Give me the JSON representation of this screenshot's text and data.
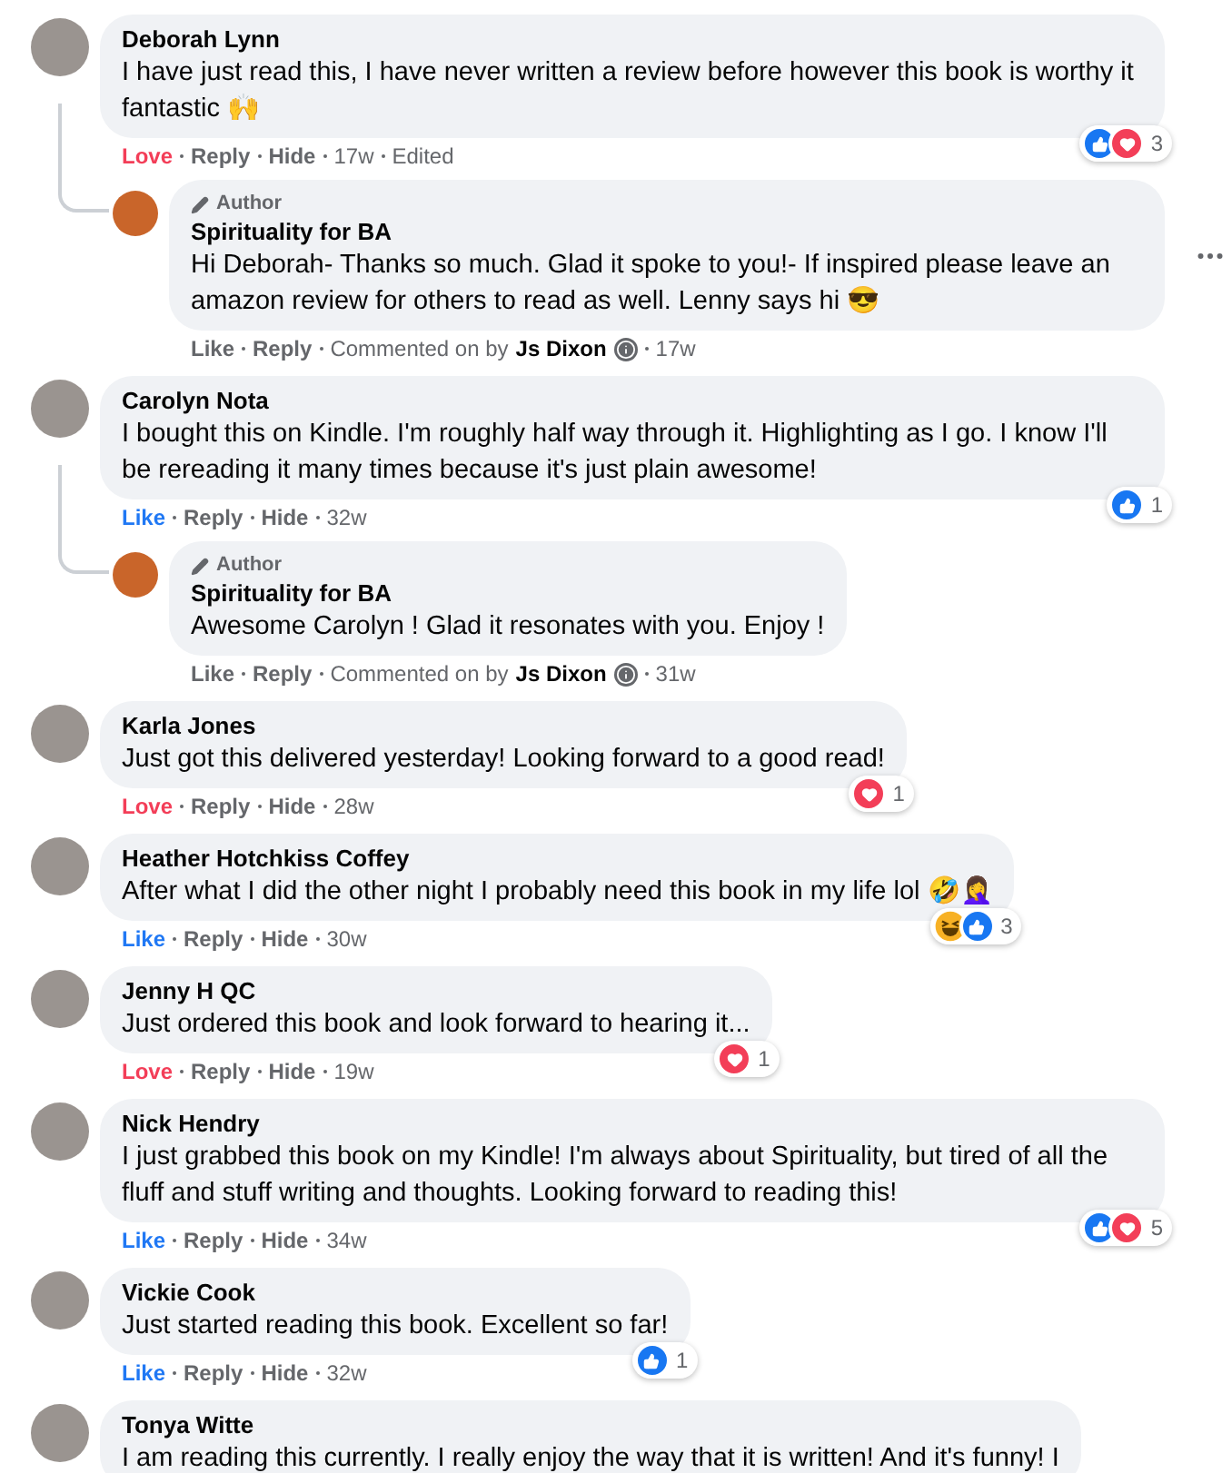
{
  "comments": [
    {
      "name": "Deborah Lynn",
      "text": "I have just read this, I have never written a review before however this book is worthy it fantastic 🙌",
      "react": {
        "label": "Love",
        "kind": "love"
      },
      "actions": [
        "Reply",
        "Hide"
      ],
      "time": "17w",
      "edited": "Edited",
      "reactions": {
        "icons": [
          {
            "kind": "like"
          },
          {
            "kind": "love"
          }
        ],
        "count": "3"
      },
      "replies": [
        {
          "badge": "Author",
          "name": "Spirituality for BA",
          "text": "Hi Deborah- Thanks so much. Glad it spoke to you!- If inspired please leave an amazon review for others to read as well. Lenny says hi 😎",
          "react": {
            "label": "Like",
            "kind": "none"
          },
          "actions": [
            "Reply"
          ],
          "commented_label": "Commented on by",
          "commented_by": "Js Dixon",
          "time": "17w",
          "menu_visible": true
        }
      ]
    },
    {
      "name": "Carolyn Nota",
      "text": "I bought this on Kindle. I'm roughly half way through it. Highlighting as I go. I know I'll be rereading it many times because it's just plain awesome!",
      "react": {
        "label": "Like",
        "kind": "like"
      },
      "actions": [
        "Reply",
        "Hide"
      ],
      "time": "32w",
      "reactions": {
        "icons": [
          {
            "kind": "like"
          }
        ],
        "count": "1"
      },
      "replies": [
        {
          "badge": "Author",
          "name": "Spirituality for BA",
          "text": "Awesome Carolyn ! Glad it resonates with you. Enjoy !",
          "react": {
            "label": "Like",
            "kind": "none"
          },
          "actions": [
            "Reply"
          ],
          "commented_label": "Commented on by",
          "commented_by": "Js Dixon",
          "time": "31w",
          "menu_visible": false
        }
      ]
    },
    {
      "name": "Karla Jones",
      "text": "Just got this delivered yesterday! Looking forward to a good read!",
      "react": {
        "label": "Love",
        "kind": "love"
      },
      "actions": [
        "Reply",
        "Hide"
      ],
      "time": "28w",
      "reactions": {
        "icons": [
          {
            "kind": "love"
          }
        ],
        "count": "1"
      }
    },
    {
      "name": "Heather Hotchkiss Coffey",
      "text": "After what I did the other night I probably need this book in my life lol 🤣🤦‍♀️",
      "react": {
        "label": "Like",
        "kind": "like"
      },
      "actions": [
        "Reply",
        "Hide"
      ],
      "time": "30w",
      "reactions": {
        "icons": [
          {
            "kind": "haha"
          },
          {
            "kind": "like"
          }
        ],
        "count": "3"
      }
    },
    {
      "name": "Jenny H QC",
      "text": "Just ordered this book and look forward to hearing it...",
      "react": {
        "label": "Love",
        "kind": "love"
      },
      "actions": [
        "Reply",
        "Hide"
      ],
      "time": "19w",
      "reactions": {
        "icons": [
          {
            "kind": "love"
          }
        ],
        "count": "1"
      }
    },
    {
      "name": "Nick Hendry",
      "text": "I just grabbed this book on my Kindle! I'm always about Spirituality, but tired of all the fluff and stuff writing and thoughts. Looking forward to reading this!",
      "react": {
        "label": "Like",
        "kind": "like"
      },
      "actions": [
        "Reply",
        "Hide"
      ],
      "time": "34w",
      "reactions": {
        "icons": [
          {
            "kind": "like"
          },
          {
            "kind": "love"
          }
        ],
        "count": "5"
      }
    },
    {
      "name": "Vickie Cook",
      "text": "Just started reading this book. Excellent so far!",
      "react": {
        "label": "Like",
        "kind": "like"
      },
      "actions": [
        "Reply",
        "Hide"
      ],
      "time": "32w",
      "reactions": {
        "icons": [
          {
            "kind": "like"
          }
        ],
        "count": "1"
      }
    },
    {
      "name": "Tonya Witte",
      "text": "I am reading this currently. I really enjoy the way that it is written! And it's funny! I"
    }
  ]
}
